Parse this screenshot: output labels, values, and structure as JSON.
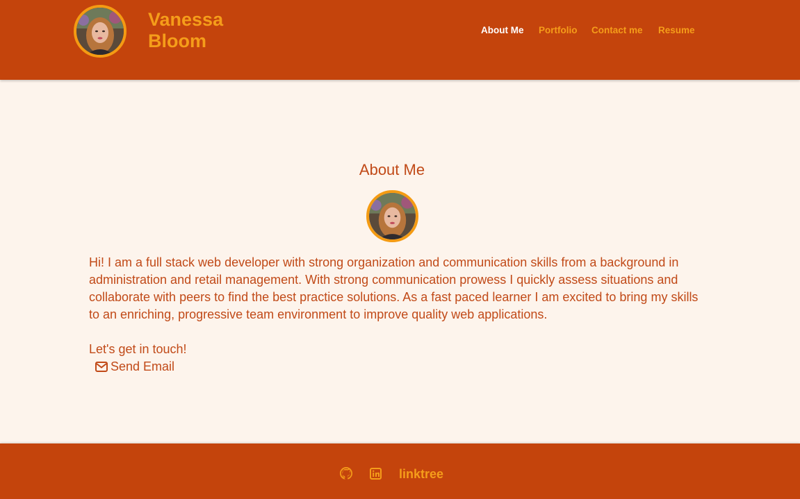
{
  "header": {
    "name_line1": "Vanessa",
    "name_line2": "Bloom",
    "nav": {
      "about": "About Me",
      "portfolio": "Portfolio",
      "contact": "Contact me",
      "resume": "Resume"
    }
  },
  "main": {
    "title": "About Me",
    "bio": "Hi! I am a full stack web developer with strong organization and communication skills from a background in administration and retail management. With strong communication prowess I quickly assess situations and collaborate with peers to find the best practice solutions. As a fast paced learner I am excited to bring my skills to an enriching, progressive team environment to improve quality web applications.",
    "cta": "Let's get in touch!",
    "send_email": "Send Email"
  },
  "footer": {
    "github_icon": "github-icon",
    "linkedin_icon": "linkedin-icon",
    "linktree": "linktree"
  },
  "colors": {
    "header_bg": "#c4440c",
    "accent": "#f59d1a",
    "page_bg": "#fdf4ec",
    "text": "#c14a18"
  }
}
